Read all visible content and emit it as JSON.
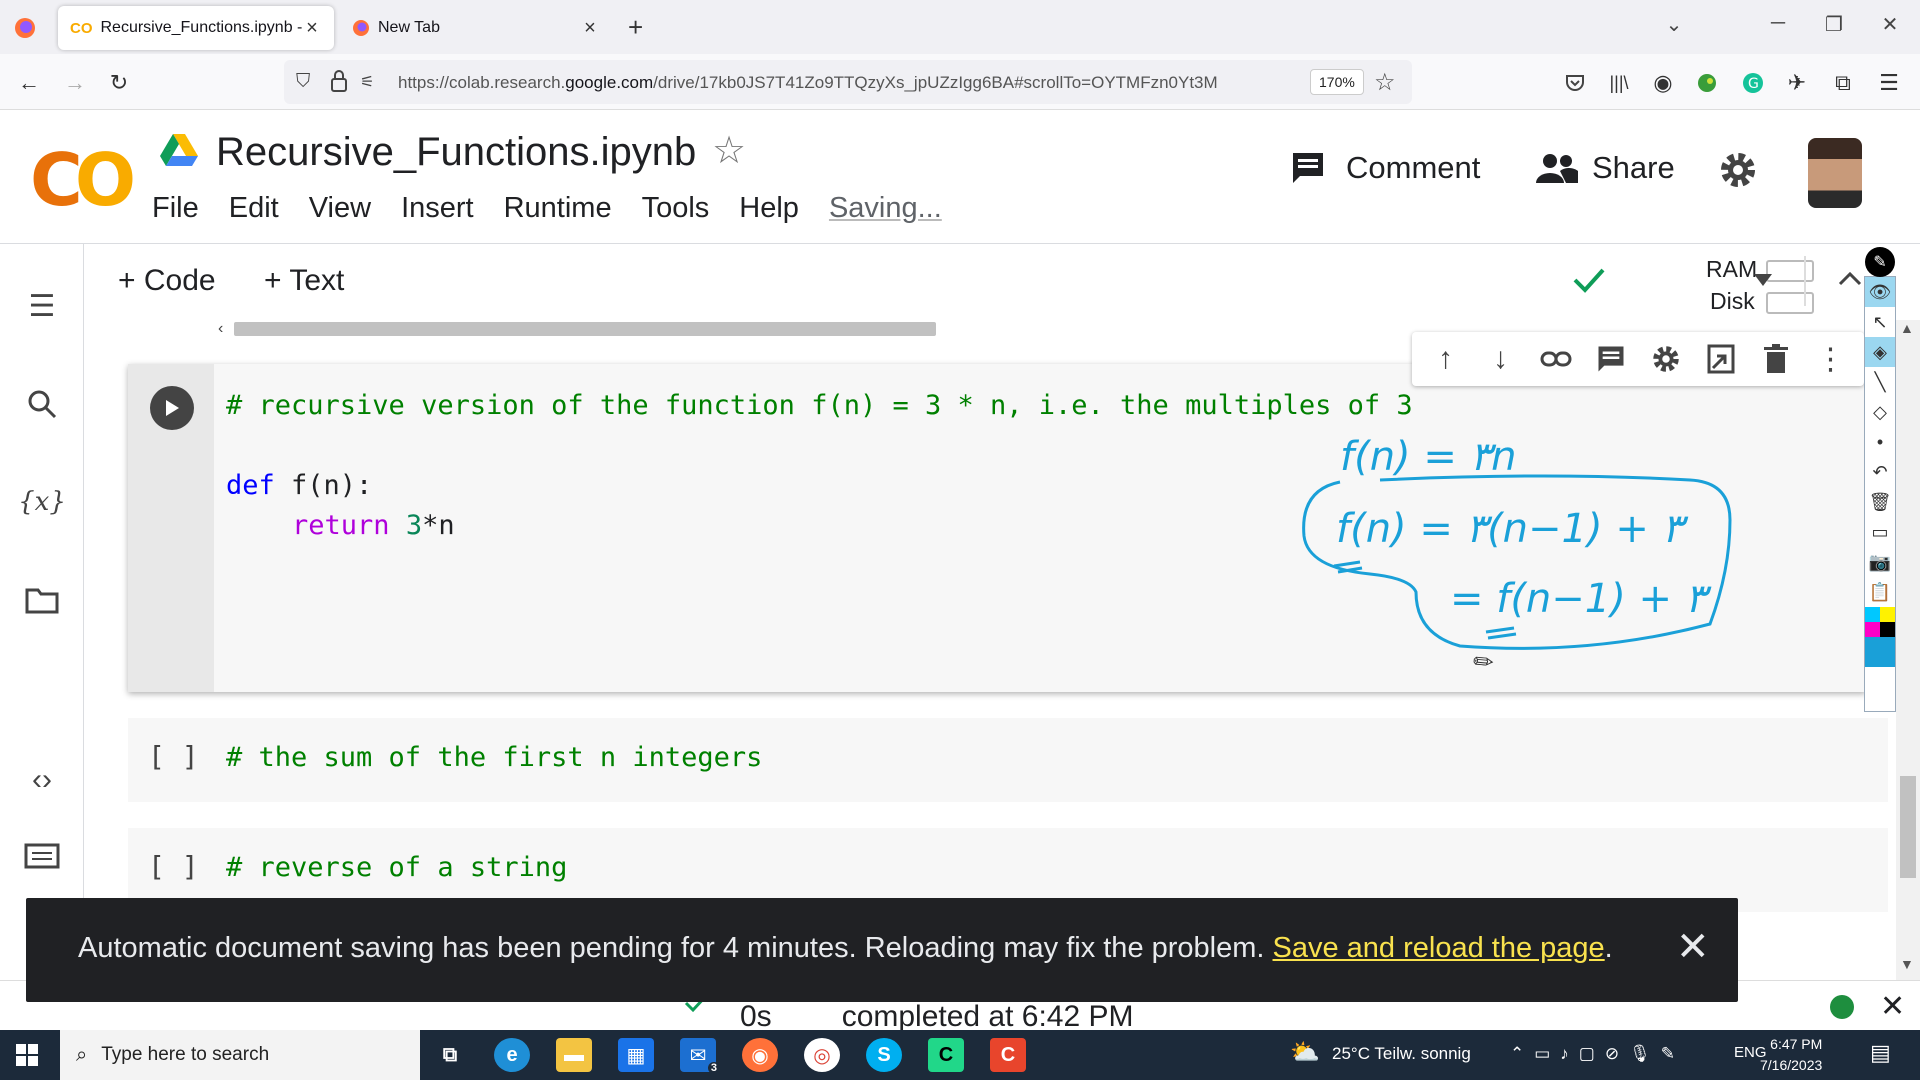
{
  "browser": {
    "tabs": [
      {
        "title": "Recursive_Functions.ipynb - Col",
        "active": true
      },
      {
        "title": "New Tab",
        "active": false
      }
    ],
    "url_prefix": "https://colab.research.",
    "url_domain": "google.com",
    "url_path": "/drive/17kb0JS7T41Zo9TTQzyXs_jpUZzIgg6BA#scrollTo=OYTMFzn0Yt3M",
    "zoom": "170%"
  },
  "colab": {
    "logo": "CO",
    "title": "Recursive_Functions.ipynb",
    "menu": [
      "File",
      "Edit",
      "View",
      "Insert",
      "Runtime",
      "Tools",
      "Help"
    ],
    "saving": "Saving...",
    "comment_label": "Comment",
    "share_label": "Share",
    "add_code": "+ Code",
    "add_text": "+ Text",
    "ram_label": "RAM",
    "disk_label": "Disk"
  },
  "cells": {
    "active": {
      "line1": "# recursive version of the function f(n) = 3 * n, i.e. the multiples of 3",
      "def_kw": "def",
      "def_rest": " f(n):",
      "return_kw": "return",
      "return_num": "3",
      "return_rest": "*n"
    },
    "idle": [
      {
        "bracket": "[ ]",
        "code": "# the sum of the first n integers"
      },
      {
        "bracket": "[ ]",
        "code": "# reverse of a string"
      }
    ]
  },
  "snackbar": {
    "message": "Automatic document saving has been pending for 4 minutes. Reloading may fix the problem. ",
    "link": "Save and reload the page",
    "suffix": "."
  },
  "status": {
    "time": "0s",
    "text": "completed at 6:42 PM"
  },
  "taskbar": {
    "search_placeholder": "Type here to search",
    "weather": "25°C  Teilw. sonnig",
    "lang": "ENG",
    "time": "6:47 PM",
    "date": "7/16/2023",
    "mail_badge": "3"
  },
  "annotation_text": {
    "line1": "f(n) = ٣n",
    "line2": "f(n) = ٣(n−1) + ٣",
    "line3": "= f(n−1) + ٣"
  },
  "colors": {
    "ink": "#1aa0d8",
    "snack_link": "#f9e24e",
    "colab_orange": "#f9ab00"
  }
}
